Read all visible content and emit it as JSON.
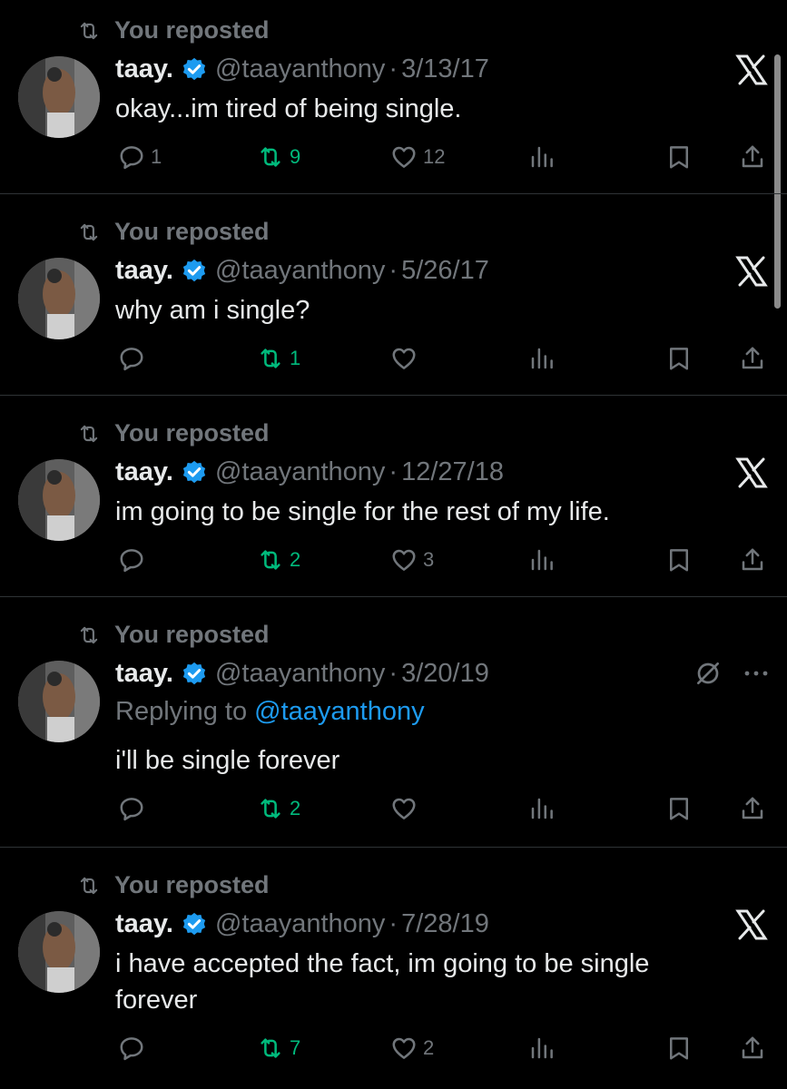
{
  "colors": {
    "background": "#000000",
    "text": "#e7e9ea",
    "muted": "#71767b",
    "repost_green": "#00ba7c",
    "verified_blue": "#1d9bf0",
    "divider": "#2f3336"
  },
  "tweets": [
    {
      "repost_label": "You reposted",
      "name": "taay.",
      "handle": "@taayanthony",
      "separator": "·",
      "date": "3/13/17",
      "text": "okay...im tired of being single.",
      "replies": "1",
      "reposts": "9",
      "likes": "12"
    },
    {
      "repost_label": "You reposted",
      "name": "taay.",
      "handle": "@taayanthony",
      "separator": "·",
      "date": "5/26/17",
      "text": "why am i single?",
      "replies": "",
      "reposts": "1",
      "likes": ""
    },
    {
      "repost_label": "You reposted",
      "name": "taay.",
      "handle": "@taayanthony",
      "separator": "·",
      "date": "12/27/18",
      "text": "im going to be single for the rest of my life.",
      "replies": "",
      "reposts": "2",
      "likes": "3"
    },
    {
      "repost_label": "You reposted",
      "name": "taay.",
      "handle": "@taayanthony",
      "separator": "·",
      "date": "3/20/19",
      "reply_prefix": "Replying to",
      "reply_mention": "@taayanthony",
      "text": "i'll be single forever",
      "replies": "",
      "reposts": "2",
      "likes": ""
    },
    {
      "repost_label": "You reposted",
      "name": "taay.",
      "handle": "@taayanthony",
      "separator": "·",
      "date": "7/28/19",
      "text": "i have accepted the fact, im going to be single forever",
      "replies": "",
      "reposts": "7",
      "likes": "2"
    }
  ]
}
